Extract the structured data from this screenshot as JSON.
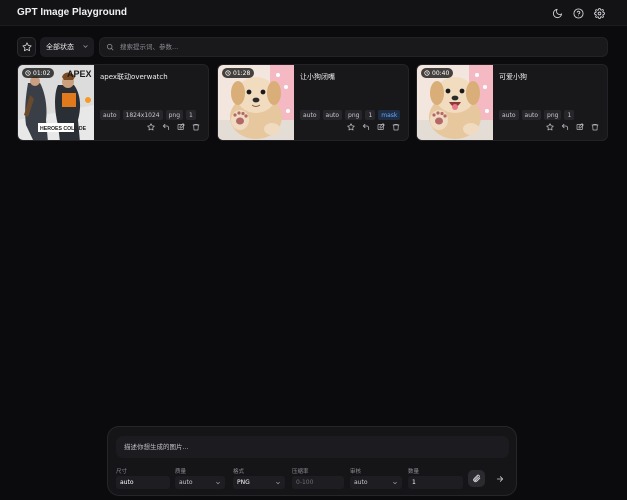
{
  "header": {
    "title": "GPT Image Playground",
    "icons": [
      "moon-icon",
      "help-icon",
      "gear-icon"
    ]
  },
  "toolbar": {
    "favorite_icon": "star-icon",
    "status_filter": "全部状态",
    "search_placeholder": "搜索提示词、参数..."
  },
  "cards": [
    {
      "time": "01:02",
      "title": "apex联动overwatch",
      "tags": [
        "auto",
        "1824x1024",
        "png",
        "1"
      ],
      "thumb": "apex-poster"
    },
    {
      "time": "01:28",
      "title": "让小狗闭嘴",
      "tags": [
        "auto",
        "auto",
        "png",
        "1",
        "mask"
      ],
      "thumb": "puppy"
    },
    {
      "time": "00:40",
      "title": "可爱小狗",
      "tags": [
        "auto",
        "auto",
        "png",
        "1"
      ],
      "thumb": "puppy-open-mouth"
    }
  ],
  "composer": {
    "prompt_placeholder": "描述你想生成的图片...",
    "params": {
      "size": {
        "label": "尺寸",
        "value": "auto"
      },
      "quality": {
        "label": "质量",
        "value": "auto"
      },
      "format": {
        "label": "格式",
        "value": "PNG"
      },
      "compression": {
        "label": "压缩率",
        "placeholder": "0-100"
      },
      "moderation": {
        "label": "审核",
        "value": "auto"
      },
      "count": {
        "label": "数量",
        "value": "1"
      }
    }
  },
  "colors": {
    "background": "#0b0b0d",
    "card": "#18181b",
    "mask_tag": "#6aa8ff"
  }
}
